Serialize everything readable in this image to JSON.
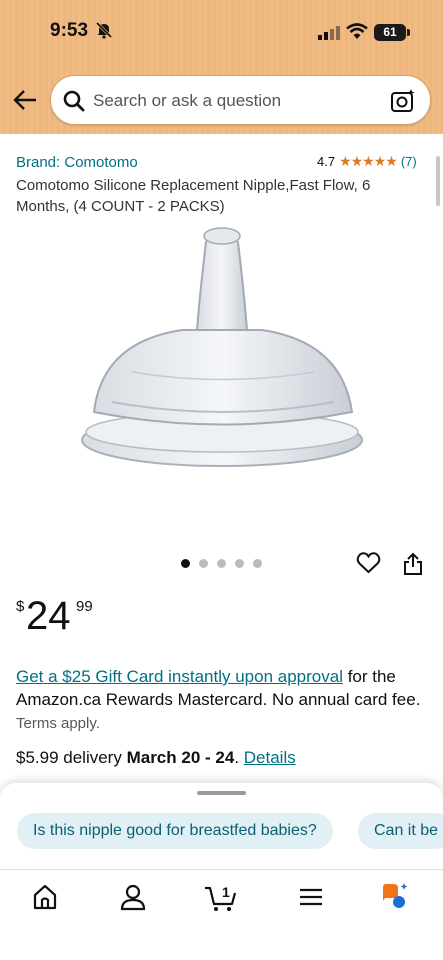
{
  "status_bar": {
    "time": "9:53",
    "battery": "61"
  },
  "search": {
    "placeholder": "Search or ask a question"
  },
  "product": {
    "brand": "Brand: Comotomo",
    "rating": "4.7",
    "stars": "★★★★★",
    "review_count": "(7)",
    "title": "Comotomo Silicone Replacement Nipple,Fast Flow, 6 Months, (4 COUNT - 2 PACKS)",
    "image_count": 5,
    "active_image": 1
  },
  "price": {
    "currency": "$",
    "whole": "24",
    "fraction": "99"
  },
  "offer": {
    "link_text": "Get a $25 Gift Card instantly upon approval",
    "text": " for the Amazon.ca Rewards Mastercard. No annual card fee. ",
    "terms": "Terms apply."
  },
  "delivery": {
    "prefix": "$5.99 delivery ",
    "dates": "March 20 - 24",
    "separator": ". ",
    "details_link": "Details"
  },
  "suggestions": [
    "Is this nipple good for breastfed babies?",
    "Can it be"
  ],
  "bottom_nav": {
    "cart_count": "1",
    "items": [
      "home-icon",
      "account-icon",
      "cart-icon",
      "menu-icon",
      "rufus-icon"
    ]
  },
  "colors": {
    "header": "#f1bb84",
    "link": "#007185",
    "star": "#de7921",
    "chip_bg": "#e0f0f5",
    "rufus_orange": "#f3731d",
    "rufus_blue": "#1a6fd6"
  }
}
